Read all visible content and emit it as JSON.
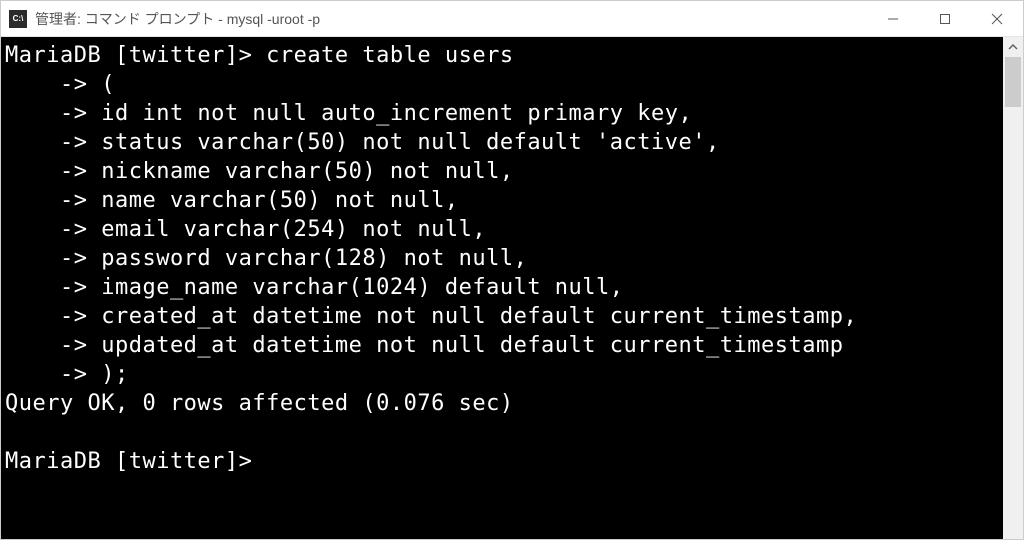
{
  "window": {
    "title": "管理者: コマンド プロンプト - mysql  -uroot -p",
    "icon_label": "C:\\"
  },
  "terminal": {
    "lines": [
      "MariaDB [twitter]> create table users",
      "    -> (",
      "    -> id int not null auto_increment primary key,",
      "    -> status varchar(50) not null default 'active',",
      "    -> nickname varchar(50) not null,",
      "    -> name varchar(50) not null,",
      "    -> email varchar(254) not null,",
      "    -> password varchar(128) not null,",
      "    -> image_name varchar(1024) default null,",
      "    -> created_at datetime not null default current_timestamp,",
      "    -> updated_at datetime not null default current_timestamp",
      "    -> );",
      "Query OK, 0 rows affected (0.076 sec)",
      "",
      "MariaDB [twitter]>"
    ]
  }
}
